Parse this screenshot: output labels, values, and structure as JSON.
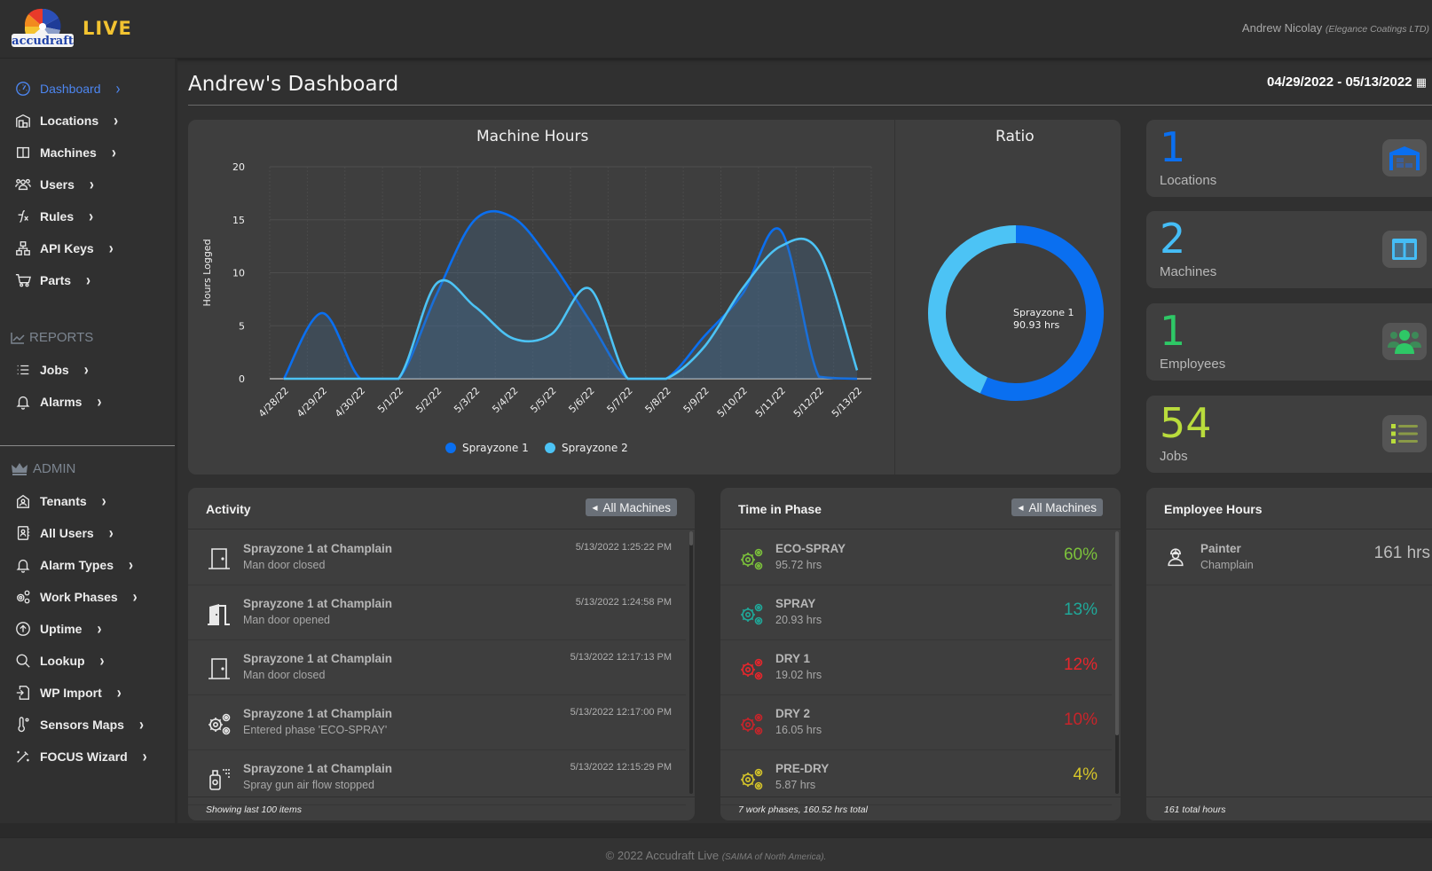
{
  "app": {
    "brand": "accudraft",
    "live_label": "LIVE"
  },
  "user": {
    "name": "Andrew Nicolay",
    "tenant": "(Elegance Coatings LTD)"
  },
  "sidebar": {
    "items": [
      {
        "label": "Dashboard",
        "icon": "dashboard-icon",
        "active": true
      },
      {
        "label": "Locations",
        "icon": "building-icon"
      },
      {
        "label": "Machines",
        "icon": "columns-icon"
      },
      {
        "label": "Users",
        "icon": "users-icon"
      },
      {
        "label": "Rules",
        "icon": "function-icon"
      },
      {
        "label": "API Keys",
        "icon": "diagram-icon"
      },
      {
        "label": "Parts",
        "icon": "cart-icon"
      }
    ],
    "reports_header": "REPORTS",
    "reports": [
      {
        "label": "Jobs",
        "icon": "list-icon"
      },
      {
        "label": "Alarms",
        "icon": "bell-icon"
      }
    ],
    "admin_header": "ADMIN",
    "admin": [
      {
        "label": "Tenants",
        "icon": "house-user-icon"
      },
      {
        "label": "All Users",
        "icon": "contact-book-icon"
      },
      {
        "label": "Alarm Types",
        "icon": "bell-icon"
      },
      {
        "label": "Work Phases",
        "icon": "gears-icon"
      },
      {
        "label": "Uptime",
        "icon": "arrow-up-circle-icon"
      },
      {
        "label": "Lookup",
        "icon": "search-icon"
      },
      {
        "label": "WP Import",
        "icon": "file-import-icon"
      },
      {
        "label": "Sensors Maps",
        "icon": "thermometer-icon"
      },
      {
        "label": "FOCUS Wizard",
        "icon": "magic-wand-icon"
      }
    ],
    "chevron": "›"
  },
  "main": {
    "title": "Andrew's Dashboard",
    "date_range": "04/29/2022 - 05/13/2022"
  },
  "chart_data": [
    {
      "type": "area",
      "title": "Machine Hours",
      "xlabel": "",
      "ylabel": "Hours Logged",
      "ylim": [
        0,
        20
      ],
      "yticks": [
        0,
        5,
        10,
        15,
        20
      ],
      "grid": true,
      "legend": "bottom",
      "x": [
        "4/28/22",
        "4/29/22",
        "4/30/22",
        "5/1/22",
        "5/2/22",
        "5/3/22",
        "5/4/22",
        "5/5/22",
        "5/6/22",
        "5/7/22",
        "5/8/22",
        "5/9/22",
        "5/10/22",
        "5/11/22",
        "5/12/22",
        "5/13/22"
      ],
      "series": [
        {
          "name": "Sprayzone 1",
          "color": "#0a6ff0",
          "values": [
            0,
            6.2,
            0,
            0,
            8,
            15,
            15.2,
            11,
            5.5,
            0,
            0,
            4,
            8,
            14,
            0.2,
            0
          ]
        },
        {
          "name": "Sprayzone 2",
          "color": "#4cc3f5",
          "values": [
            0,
            0,
            0,
            0,
            9,
            6.8,
            3.8,
            4.2,
            8.5,
            0,
            0,
            3,
            8.5,
            12.5,
            12,
            0.8
          ]
        }
      ]
    },
    {
      "type": "pie",
      "title": "Ratio",
      "donut": true,
      "slices": [
        {
          "name": "Sprayzone 1",
          "value": 90.93,
          "color": "#0a6ff0"
        },
        {
          "name": "Sprayzone 2",
          "value": 69.59,
          "color": "#4cc3f5"
        }
      ],
      "tooltip": {
        "line1": "Sprayzone 1",
        "line2": "90.93 hrs"
      }
    }
  ],
  "stats": [
    {
      "value": "1",
      "label": "Locations",
      "color": "#0a6ff0",
      "icon": "warehouse-icon"
    },
    {
      "value": "2",
      "label": "Machines",
      "color": "#45bdf6",
      "icon": "columns-icon"
    },
    {
      "value": "1",
      "label": "Employees",
      "color": "#2ec866",
      "icon": "users-icon"
    },
    {
      "value": "54",
      "label": "Jobs",
      "color": "#b9dc3c",
      "icon": "list-icon"
    }
  ],
  "activity": {
    "title": "Activity",
    "filter_label": "All Machines",
    "items": [
      {
        "title": "Sprayzone 1 at Champlain",
        "sub": "Man door closed",
        "time": "5/13/2022 1:25:22 PM",
        "icon": "door-closed-icon"
      },
      {
        "title": "Sprayzone 1 at Champlain",
        "sub": "Man door opened",
        "time": "5/13/2022 1:24:58 PM",
        "icon": "door-open-icon"
      },
      {
        "title": "Sprayzone 1 at Champlain",
        "sub": "Man door closed",
        "time": "5/13/2022 12:17:13 PM",
        "icon": "door-closed-icon"
      },
      {
        "title": "Sprayzone 1 at Champlain",
        "sub": "Entered phase 'ECO-SPRAY'",
        "time": "5/13/2022 12:17:00 PM",
        "icon": "gears-icon"
      },
      {
        "title": "Sprayzone 1 at Champlain",
        "sub": "Spray gun air flow stopped",
        "time": "5/13/2022 12:15:29 PM",
        "icon": "spray-can-icon"
      }
    ],
    "footer": "Showing last 100 items"
  },
  "phases": {
    "title": "Time in Phase",
    "filter_label": "All Machines",
    "items": [
      {
        "name": "ECO-SPRAY",
        "hours": "95.72 hrs",
        "pct": "60%",
        "color": "#7cc23b"
      },
      {
        "name": "SPRAY",
        "hours": "20.93 hrs",
        "pct": "13%",
        "color": "#1fa99a"
      },
      {
        "name": "DRY 1",
        "hours": "19.02 hrs",
        "pct": "12%",
        "color": "#e8262c"
      },
      {
        "name": "DRY 2",
        "hours": "16.05 hrs",
        "pct": "10%",
        "color": "#c8242a"
      },
      {
        "name": "PRE-DRY",
        "hours": "5.87 hrs",
        "pct": "4%",
        "color": "#d6c52a"
      }
    ],
    "footer": "7 work phases, 160.52 hrs total"
  },
  "employees": {
    "title": "Employee Hours",
    "items": [
      {
        "role": "Painter",
        "location": "Champlain",
        "hours": "161 hrs"
      }
    ],
    "footer": "161 total hours"
  },
  "footer": {
    "copyright": "© 2022 Accudraft Live",
    "sub": "(SAIMA of North America)."
  }
}
